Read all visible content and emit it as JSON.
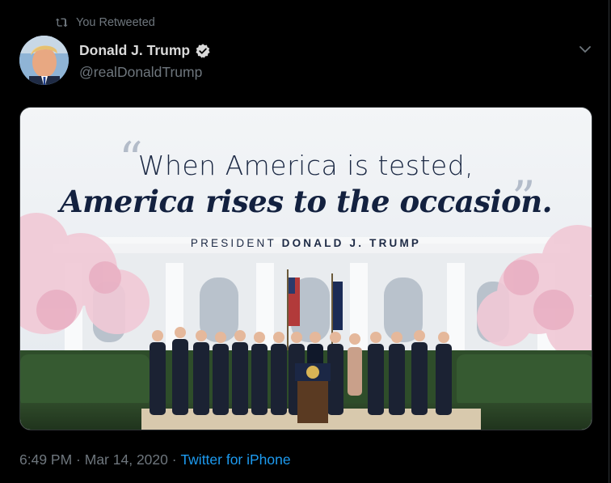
{
  "social_context": {
    "text": "You Retweeted",
    "icon": "retweet-icon"
  },
  "author": {
    "display_name": "Donald J. Trump",
    "handle": "@realDonaldTrump",
    "verified_icon": "verified-badge-icon"
  },
  "menu": {
    "icon": "chevron-down-icon"
  },
  "media": {
    "quote_line1": "When America is tested,",
    "quote_line2": "America rises to the occasion.",
    "attribution_prefix": "PRESIDENT",
    "attribution_name": "DONALD J. TRUMP"
  },
  "meta": {
    "time": "6:49 PM",
    "separator1": " · ",
    "date": "Mar 14, 2020",
    "separator2": " · ",
    "source": "Twitter for iPhone"
  },
  "colors": {
    "background": "#000000",
    "secondary_text": "#6e767d",
    "link": "#1d9bf0",
    "primary_text": "#d9d9d9"
  }
}
